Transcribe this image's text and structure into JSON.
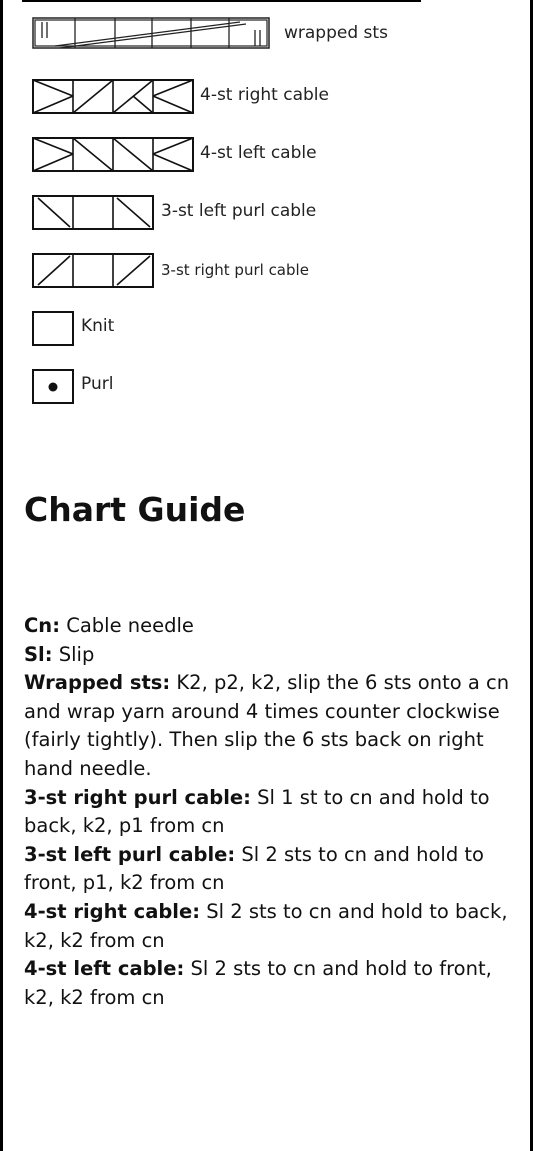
{
  "legend": [
    {
      "label": "wrapped sts",
      "icon": "wrapped-sts-symbol-icon"
    },
    {
      "label": "4-st right cable",
      "icon": "4-st-right-cable-symbol-icon"
    },
    {
      "label": "4-st left cable",
      "icon": "4-st-left-cable-symbol-icon"
    },
    {
      "label": "3-st left purl cable",
      "icon": "3-st-left-purl-cable-symbol-icon"
    },
    {
      "label": "3-st right purl cable",
      "icon": "3-st-right-purl-cable-symbol-icon"
    },
    {
      "label": "Knit",
      "icon": "knit-symbol-icon"
    },
    {
      "label": "Purl",
      "icon": "purl-dot-symbol-icon"
    }
  ],
  "title": "Chart Guide",
  "definitions": [
    {
      "term": "Cn:",
      "text": "Cable needle"
    },
    {
      "term": "Sl:",
      "text": "Slip"
    },
    {
      "term": "Wrapped sts:",
      "text": "K2, p2, k2, slip the 6 sts onto a cn and wrap yarn around 4 times counter clockwise (fairly tightly). Then slip the 6 sts back on right hand needle."
    },
    {
      "term": "3-st right purl cable:",
      "text": "Sl 1 st to cn and hold to back, k2, p1 from cn"
    },
    {
      "term": "3-st left purl cable:",
      "text": "Sl 2 sts to cn and hold to front, p1, k2 from cn"
    },
    {
      "term": "4-st right cable:",
      "text": "Sl 2 sts to cn and hold to back, k2, k2 from cn"
    },
    {
      "term": "4-st left cable:",
      "text": "Sl 2 sts to cn and hold to front, k2, k2 from cn"
    }
  ],
  "colors": {
    "text": "#111111",
    "border": "#000000",
    "background": "#ffffff"
  }
}
